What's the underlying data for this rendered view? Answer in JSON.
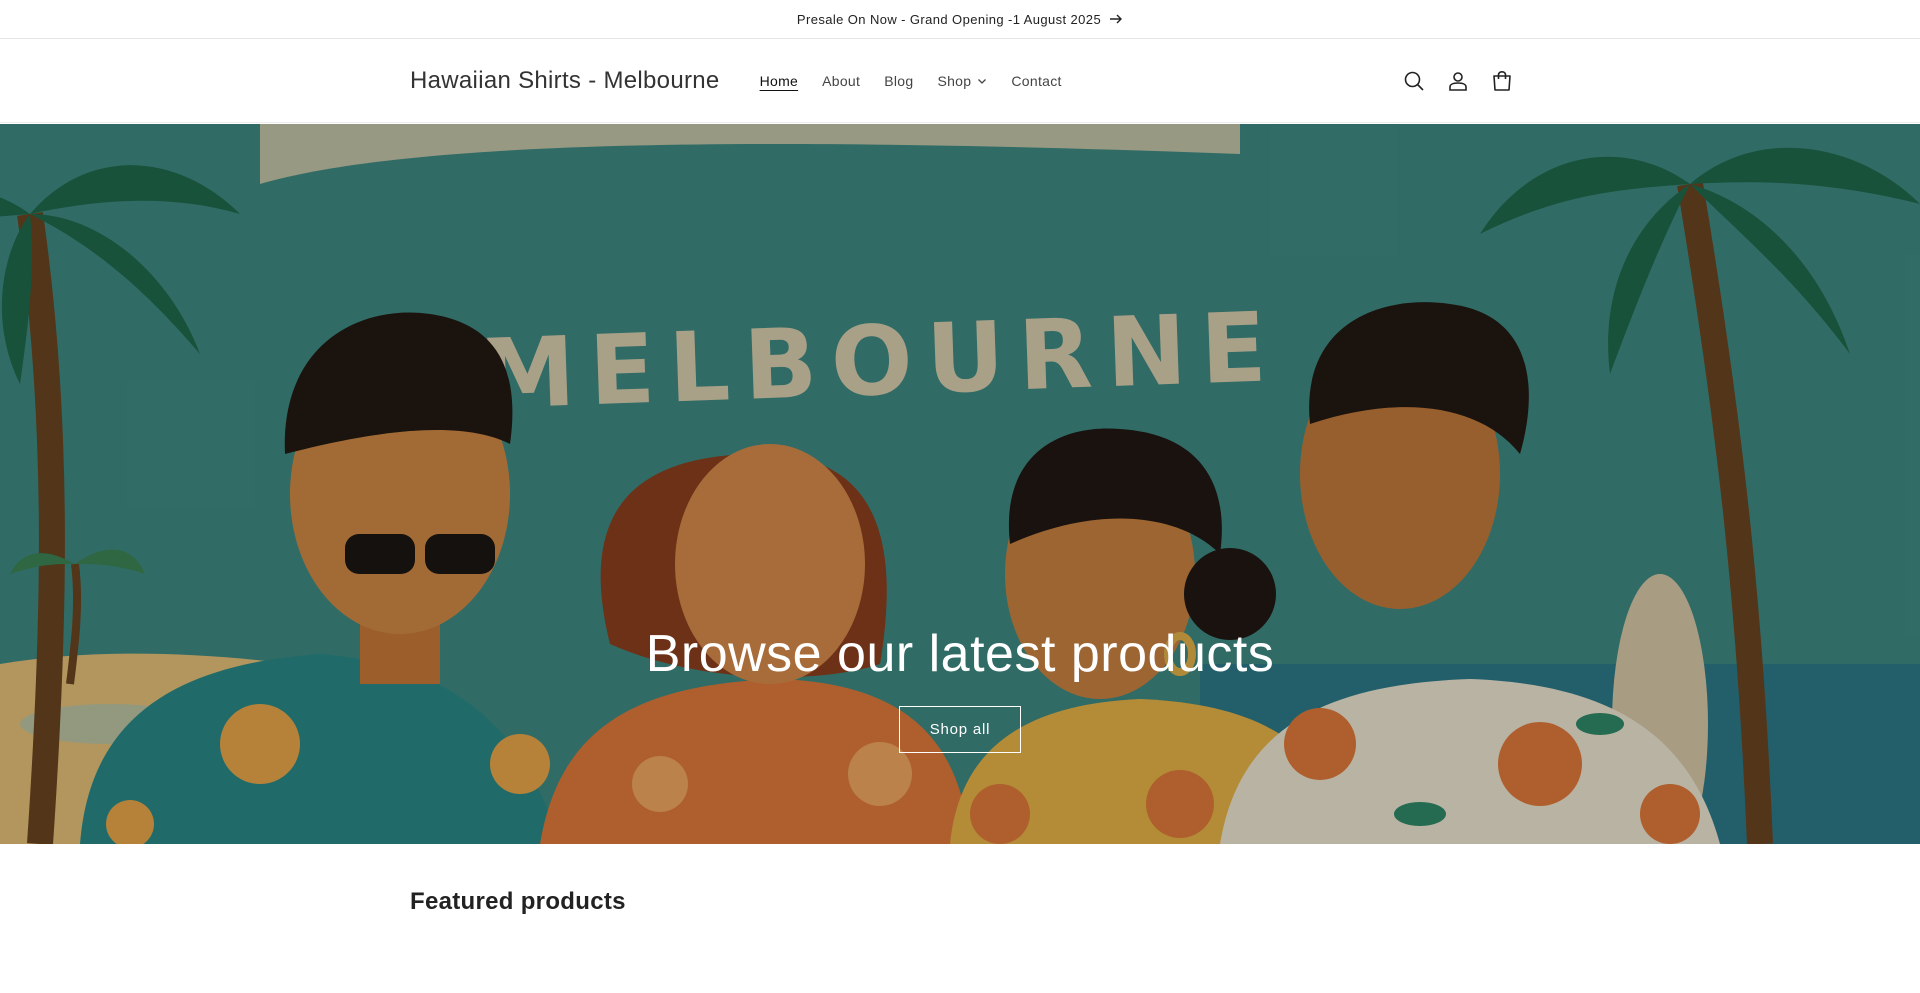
{
  "announcement": {
    "text": "Presale On Now - Grand Opening -1 August 2025"
  },
  "header": {
    "logo": "Hawaiian Shirts - Melbourne",
    "nav": [
      {
        "label": "Home",
        "active": true
      },
      {
        "label": "About"
      },
      {
        "label": "Blog"
      },
      {
        "label": "Shop",
        "has_dropdown": true
      },
      {
        "label": "Contact"
      }
    ],
    "icons": [
      "search-icon",
      "account-icon",
      "cart-icon"
    ]
  },
  "hero": {
    "banner_text": "MELBOURNE",
    "title": "Browse our latest products",
    "button": "Shop all"
  },
  "featured": {
    "heading": "Featured products"
  },
  "colors": {
    "teal": "#3f8a83",
    "sand": "#e0b878",
    "orange": "#e07a3a",
    "text": "#121212"
  }
}
